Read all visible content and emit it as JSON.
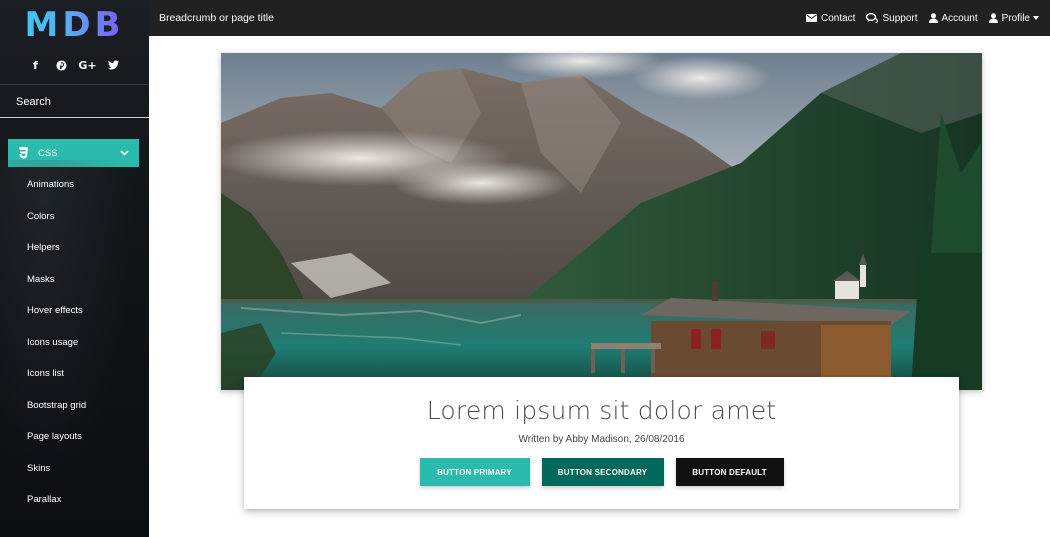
{
  "brand": {
    "logo_text": "MDB"
  },
  "social": [
    {
      "icon": "facebook-icon",
      "glyph": "f"
    },
    {
      "icon": "pinterest-icon",
      "glyph": "p"
    },
    {
      "icon": "google-plus-icon",
      "glyph": "G+"
    },
    {
      "icon": "twitter-icon",
      "glyph": "t"
    }
  ],
  "sidebar": {
    "search_placeholder": "Search",
    "section": {
      "label": "CSS",
      "icon": "css3-icon",
      "expanded": true
    },
    "items": [
      {
        "label": "Animations"
      },
      {
        "label": "Colors"
      },
      {
        "label": "Helpers"
      },
      {
        "label": "Masks"
      },
      {
        "label": "Hover effects"
      },
      {
        "label": "Icons usage"
      },
      {
        "label": "Icons list"
      },
      {
        "label": "Bootstrap grid"
      },
      {
        "label": "Page layouts"
      },
      {
        "label": "Skins"
      },
      {
        "label": "Parallax"
      }
    ]
  },
  "topnav": {
    "breadcrumb": "Breadcrumb or page title",
    "links": [
      {
        "label": "Contact",
        "icon": "envelope-icon"
      },
      {
        "label": "Support",
        "icon": "comments-icon"
      },
      {
        "label": "Account",
        "icon": "user-icon"
      },
      {
        "label": "Profile",
        "icon": "user-icon",
        "dropdown": true
      }
    ]
  },
  "card": {
    "title": "Lorem ipsum sit dolor amet",
    "meta": "Written by Abby Madison, 26/08/2016",
    "buttons": {
      "primary": "BUTTON PRIMARY",
      "secondary": "BUTTON SECONDARY",
      "default": "BUTTON DEFAULT"
    }
  },
  "colors": {
    "accent": "#2bbbad",
    "secondary": "#00695c",
    "default": "#111111",
    "navbar": "#212121",
    "sidebar": "#121518"
  }
}
